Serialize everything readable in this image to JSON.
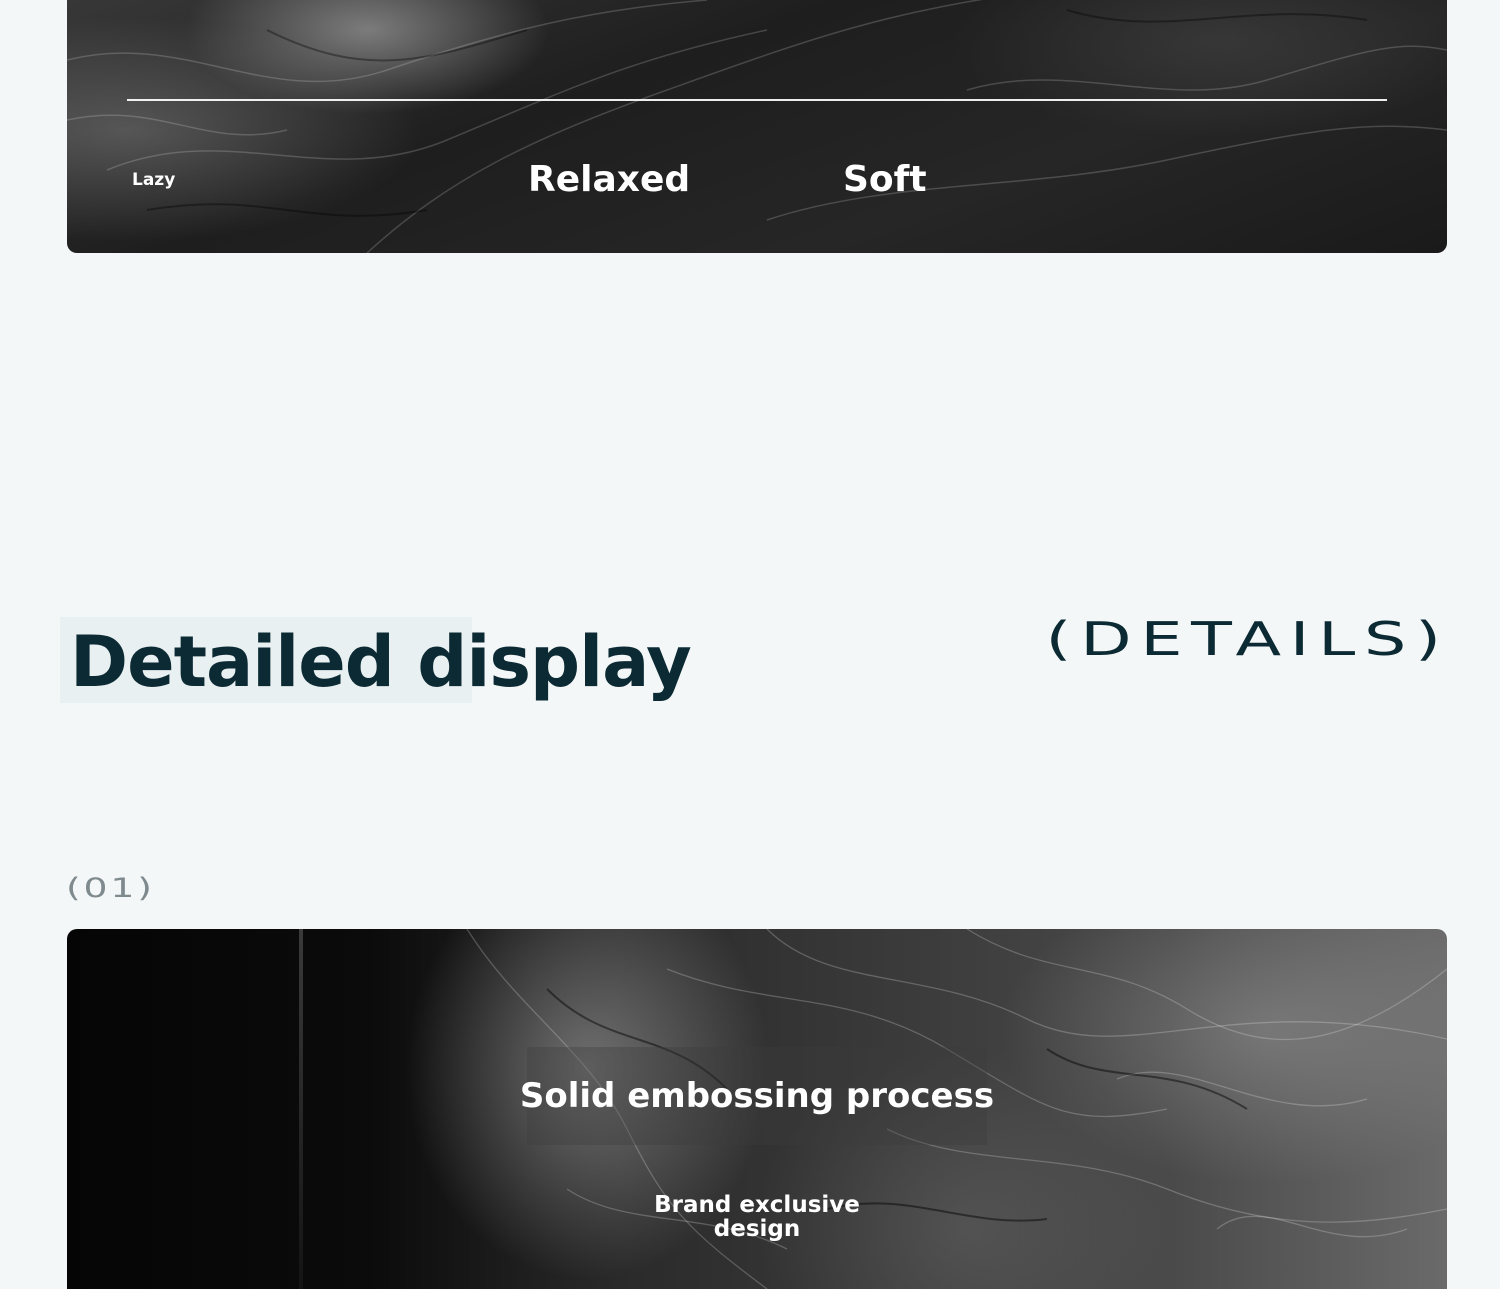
{
  "banner": {
    "tags": [
      "Lazy",
      "Relaxed",
      "Soft"
    ]
  },
  "section": {
    "title": "Detailed display",
    "tag": "(DETAILS)"
  },
  "detail": {
    "index": "(01)",
    "title": "Solid embossing process",
    "subtitle": "Brand exclusive design"
  }
}
